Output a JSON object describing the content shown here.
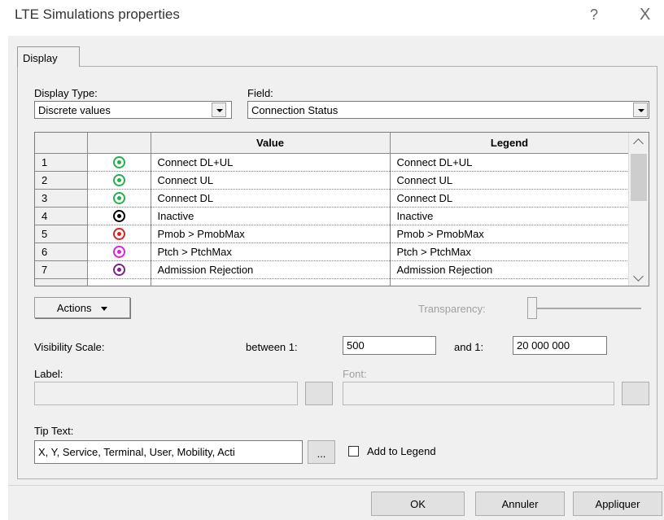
{
  "window": {
    "title": "LTE Simulations properties",
    "help_glyph": "?",
    "close_glyph": "X"
  },
  "tabs": [
    {
      "label": "Display"
    }
  ],
  "display_type": {
    "label": "Display Type:",
    "value": "Discrete values"
  },
  "field": {
    "label": "Field:",
    "value": "Connection Status"
  },
  "grid": {
    "columns": [
      "",
      "",
      "Value",
      "Legend"
    ],
    "rows": [
      {
        "num": "1",
        "icon": "green-target-icon",
        "color": "#22b14c",
        "value": "Connect DL+UL",
        "legend": "Connect DL+UL"
      },
      {
        "num": "2",
        "icon": "green-target-icon",
        "color": "#22b14c",
        "value": "Connect UL",
        "legend": "Connect UL"
      },
      {
        "num": "3",
        "icon": "green-target-icon",
        "color": "#22b14c",
        "value": "Connect DL",
        "legend": "Connect DL"
      },
      {
        "num": "4",
        "icon": "black-target-icon",
        "color": "#000000",
        "value": "Inactive",
        "legend": "Inactive"
      },
      {
        "num": "5",
        "icon": "red-target-icon",
        "color": "#e02020",
        "value": "Pmob > PmobMax",
        "legend": "Pmob > PmobMax"
      },
      {
        "num": "6",
        "icon": "magenta-target-icon",
        "color": "#e020e0",
        "value": "Ptch > PtchMax",
        "legend": "Ptch > PtchMax"
      },
      {
        "num": "7",
        "icon": "purple-target-icon",
        "color": "#80208a",
        "value": "Admission Rejection",
        "legend": "Admission Rejection"
      }
    ]
  },
  "actions_button": {
    "label": "Actions"
  },
  "transparency": {
    "label": "Transparency:"
  },
  "visibility": {
    "label": "Visibility Scale:",
    "between_label": "between 1:",
    "between_value": "500",
    "and_label": "and 1:",
    "and_value": "20 000 000"
  },
  "label_field": {
    "label": "Label:",
    "button": ""
  },
  "font_field": {
    "label": "Font:",
    "button": ""
  },
  "tip_text": {
    "label": "Tip Text:",
    "value": "X, Y, Service, Terminal, User, Mobility, Acti",
    "button": "..."
  },
  "add_to_legend": {
    "label": "Add to Legend"
  },
  "footer": {
    "ok": "OK",
    "cancel": "Annuler",
    "apply": "Appliquer"
  }
}
